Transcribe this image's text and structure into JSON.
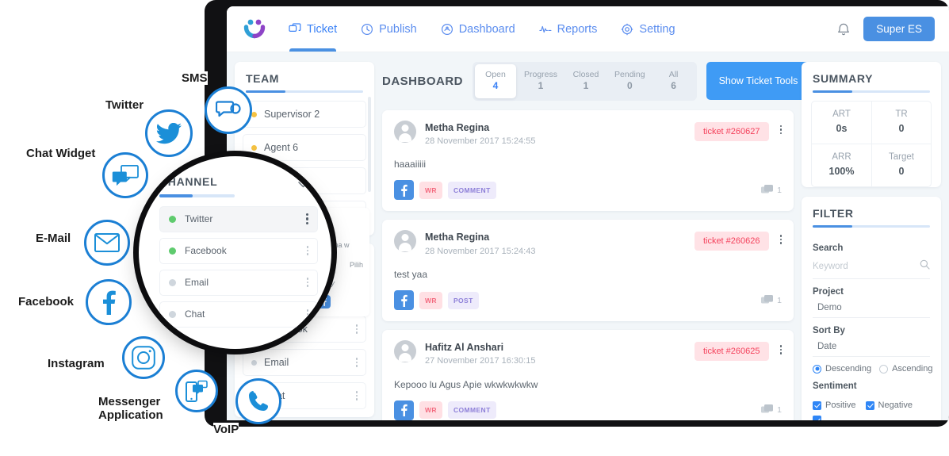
{
  "app": {
    "logo_icon": "smiley-logo",
    "nav": [
      {
        "label": "Ticket",
        "icon": "ticket-icon",
        "active": true
      },
      {
        "label": "Publish",
        "icon": "publish-icon",
        "active": false
      },
      {
        "label": "Dashboard",
        "icon": "dashboard-icon",
        "active": false
      },
      {
        "label": "Reports",
        "icon": "reports-icon",
        "active": false
      },
      {
        "label": "Setting",
        "icon": "gear-icon",
        "active": false
      }
    ],
    "notification_icon": "bell-icon",
    "user_button": "Super ES",
    "accent_color": "#4a90e2",
    "danger_color": "#f4425c"
  },
  "team_panel": {
    "title": "TEAM",
    "members": [
      {
        "name": "Supervisor 2",
        "status": "away"
      },
      {
        "name": "Agent 6",
        "status": "away"
      }
    ]
  },
  "channel_panel": {
    "title": "CHANNEL",
    "collapse_icon": "chevron-down-icon",
    "channels": [
      {
        "name": "Twitter",
        "status": "online",
        "selected": true
      },
      {
        "name": "Facebook",
        "status": "online",
        "selected": false
      },
      {
        "name": "Email",
        "status": "offline",
        "selected": false
      },
      {
        "name": "Chat",
        "status": "offline",
        "selected": false
      }
    ]
  },
  "dashboard": {
    "title": "DASHBOARD",
    "status_tabs": [
      {
        "label": "Open",
        "count": "4",
        "active": true
      },
      {
        "label": "Progress",
        "count": "1",
        "active": false
      },
      {
        "label": "Closed",
        "count": "1",
        "active": false
      },
      {
        "label": "Pending",
        "count": "0",
        "active": false
      },
      {
        "label": "All",
        "count": "6",
        "active": false
      }
    ],
    "tools_button": "Show Ticket Tools",
    "tickets": [
      {
        "author": "Metha Regina",
        "timestamp": "28 November 2017 15:24:55",
        "ticket_id": "ticket #260627",
        "message": "haaaiiiii",
        "source_icon": "facebook-icon",
        "tag_priority": "WR",
        "tag_type": "COMMENT",
        "comment_count": "1"
      },
      {
        "author": "Metha Regina",
        "timestamp": "28 November 2017 15:24:43",
        "ticket_id": "ticket #260626",
        "message": "test yaa",
        "source_icon": "facebook-icon",
        "tag_priority": "WR",
        "tag_type": "POST",
        "comment_count": "1"
      },
      {
        "author": "Hafitz Al Anshari",
        "timestamp": "27 November 2017 16:30:15",
        "ticket_id": "ticket #260625",
        "message": "Kepooo lu Agus Apie wkwkwkwkw",
        "source_icon": "facebook-icon",
        "tag_priority": "WR",
        "tag_type": "COMMENT",
        "comment_count": "1"
      }
    ]
  },
  "summary": {
    "title": "SUMMARY",
    "metrics": [
      {
        "key": "ART",
        "value": "0s"
      },
      {
        "key": "TR",
        "value": "0"
      },
      {
        "key": "ARR",
        "value": "100%"
      },
      {
        "key": "Target",
        "value": "0"
      }
    ]
  },
  "filter": {
    "title": "FILTER",
    "search_label": "Search",
    "search_value": "",
    "search_placeholder": "Keyword",
    "search_icon": "search-icon",
    "project_label": "Project",
    "project_value": "Demo",
    "sort_label": "Sort By",
    "sort_value": "Date",
    "sort_options": [
      {
        "label": "Descending",
        "selected": true
      },
      {
        "label": "Ascending",
        "selected": false
      }
    ],
    "sentiment_label": "Sentiment",
    "sentiment_options": [
      {
        "label": "Positive",
        "checked": true
      },
      {
        "label": "Negative",
        "checked": true
      }
    ]
  },
  "hidden_card": {
    "text_1": "Gimana w",
    "text_2": "Pilih",
    "text_3": "Ricky"
  },
  "channel_callouts": [
    {
      "label": "SMS",
      "icon": "sms-icon"
    },
    {
      "label": "Twitter",
      "icon": "twitter-icon"
    },
    {
      "label": "Chat Widget",
      "icon": "chat-icon"
    },
    {
      "label": "E-Mail",
      "icon": "email-icon"
    },
    {
      "label": "Facebook",
      "icon": "facebook-icon"
    },
    {
      "label": "Instagram",
      "icon": "instagram-icon"
    },
    {
      "label": "Messenger\nApplication",
      "icon": "messenger-icon"
    },
    {
      "label": "VoIP",
      "icon": "phone-icon"
    }
  ]
}
